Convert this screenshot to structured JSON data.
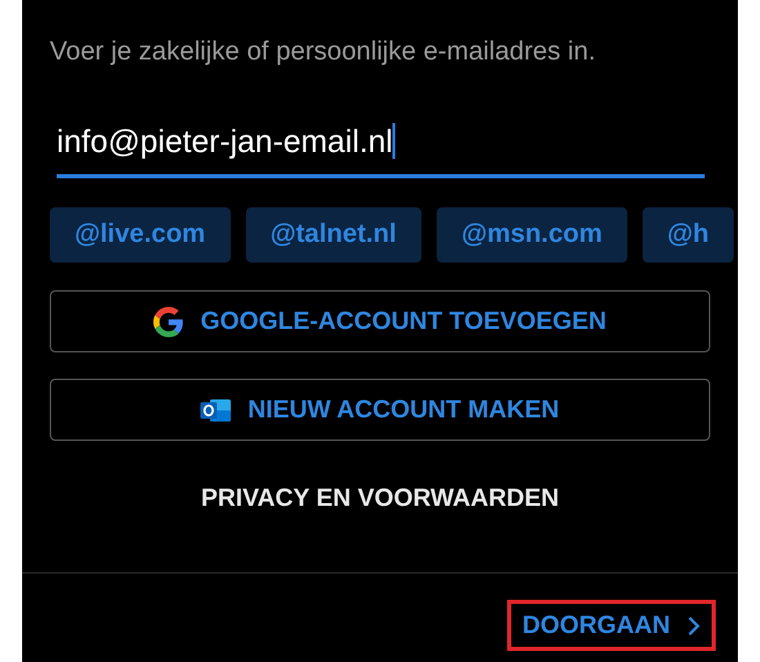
{
  "prompt": "Voer je zakelijke of persoonlijke e-mailadres in.",
  "email": {
    "value": "info@pieter-jan-email.nl",
    "focused": true
  },
  "suggestions": [
    "@live.com",
    "@talnet.nl",
    "@msn.com",
    "@h"
  ],
  "buttons": [
    {
      "kind": "google",
      "label": "GOOGLE-ACCOUNT TOEVOEGEN"
    },
    {
      "kind": "outlook",
      "label": "NIEUW ACCOUNT MAKEN"
    }
  ],
  "privacy_link": "PRIVACY EN VOORWAARDEN",
  "continue": {
    "label": "DOORGAAN",
    "highlighted": true
  }
}
